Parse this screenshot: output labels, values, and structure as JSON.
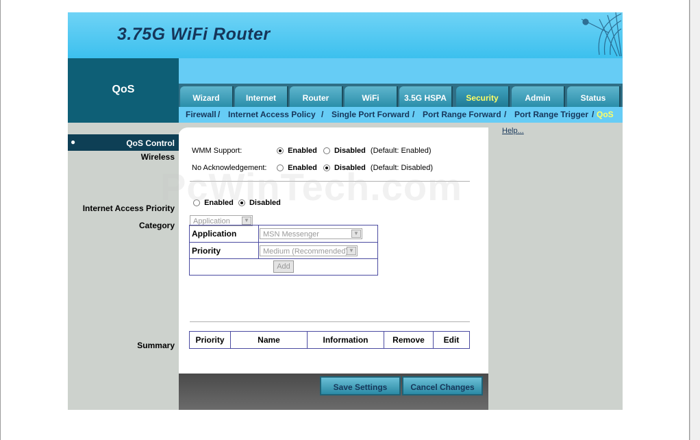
{
  "banner": {
    "title": "3.75G WiFi Router"
  },
  "section": {
    "title": "QoS"
  },
  "tabs": [
    {
      "label": "Wizard"
    },
    {
      "label": "Internet"
    },
    {
      "label": "Router"
    },
    {
      "label": "WiFi"
    },
    {
      "label": "3.5G HSPA"
    },
    {
      "label": "Security",
      "active": true
    },
    {
      "label": "Admin"
    },
    {
      "label": "Status"
    }
  ],
  "subtabs": {
    "firewall": "Firewall",
    "internet_access_policy": "Internet Access Policy",
    "single_port_forward": "Single Port Forward",
    "port_range_forward": "Port Range Forward",
    "port_range_trigger": "Port Range Trigger",
    "qos": "QoS",
    "sep": "/"
  },
  "left": {
    "qos_control": "QoS Control",
    "wireless": "Wireless",
    "internet_access_priority": "Internet Access Priority",
    "category": "Category",
    "summary": "Summary"
  },
  "help": "Help...",
  "wireless": {
    "wmm_label": "WMM Support:",
    "wmm_enabled": "Enabled",
    "wmm_disabled": "Disabled",
    "wmm_default": "(Default: Enabled)",
    "noack_label": "No Acknowledgement:",
    "noack_enabled": "Enabled",
    "noack_disabled": "Disabled",
    "noack_default": "(Default: Disabled)"
  },
  "iap": {
    "enabled": "Enabled",
    "disabled": "Disabled"
  },
  "category": {
    "value": "Application"
  },
  "form": {
    "application_label": "Application",
    "application_value": "MSN Messenger",
    "priority_label": "Priority",
    "priority_value": "Medium (Recommended)",
    "add": "Add"
  },
  "summary_headers": [
    "Priority",
    "Name",
    "Information",
    "Remove",
    "Edit"
  ],
  "footer": {
    "save": "Save Settings",
    "cancel": "Cancel Changes"
  },
  "watermark": "PcWinTech.com"
}
